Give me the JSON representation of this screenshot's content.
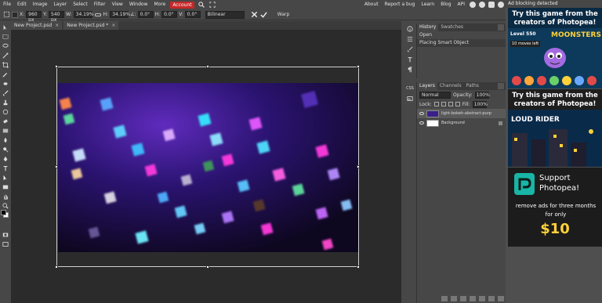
{
  "menu": {
    "items": [
      "File",
      "Edit",
      "Image",
      "Layer",
      "Select",
      "Filter",
      "View",
      "Window",
      "More",
      "Account"
    ],
    "right": [
      "About",
      "Report a bug",
      "Learn",
      "Blog",
      "API"
    ]
  },
  "options": {
    "x_label": "X:",
    "x_value": "960 px",
    "y_label": "Y:",
    "y_value": "540 px",
    "w_label": "W:",
    "w_value": "34.19%",
    "h_label": "H:",
    "h_value": "34.19%",
    "angle_label": "∠:",
    "angle_value": "0.0°",
    "hskew_label": "H:",
    "hskew_value": "0.0°",
    "vskew_label": "V:",
    "vskew_value": "0.0°",
    "interp": "Bilinear",
    "warp": "Warp"
  },
  "tabs": [
    {
      "label": "New Project.psd",
      "close": "×"
    },
    {
      "label": "New Project.psd *",
      "close": "×"
    }
  ],
  "history": {
    "tabs": [
      "History",
      "Swatches"
    ],
    "items": [
      "Open",
      "Placing Smart Object"
    ]
  },
  "vstrip": {
    "css_label": "CSS"
  },
  "layers": {
    "tabs": [
      "Layers",
      "Channels",
      "Paths"
    ],
    "blend": "Normal",
    "opacity_label": "Opacity:",
    "opacity": "100%",
    "lock_label": "Lock:",
    "fill_label": "Fill:",
    "fill": "100%",
    "rows": [
      {
        "name": "light-bokeh-abstract-purp"
      },
      {
        "name": "Background"
      }
    ]
  },
  "ads": {
    "notice": "Ad blocking detected",
    "ad1_title": "Try this game from the creators of Photopea!",
    "ad1_level": "Level 550",
    "ad1_moves": "10 moves left",
    "ad1_game": "MOONSTERS",
    "ad2_title": "Try this game from the creators of Photopea!",
    "ad2_game": "LOUD RIDER",
    "ad3_title": "Support Photopea!",
    "ad3_text": "remove ads for three months for only",
    "ad3_price": "$10"
  },
  "colors": {
    "accent": "#c62828",
    "bokeh_bg": "#140a26"
  }
}
